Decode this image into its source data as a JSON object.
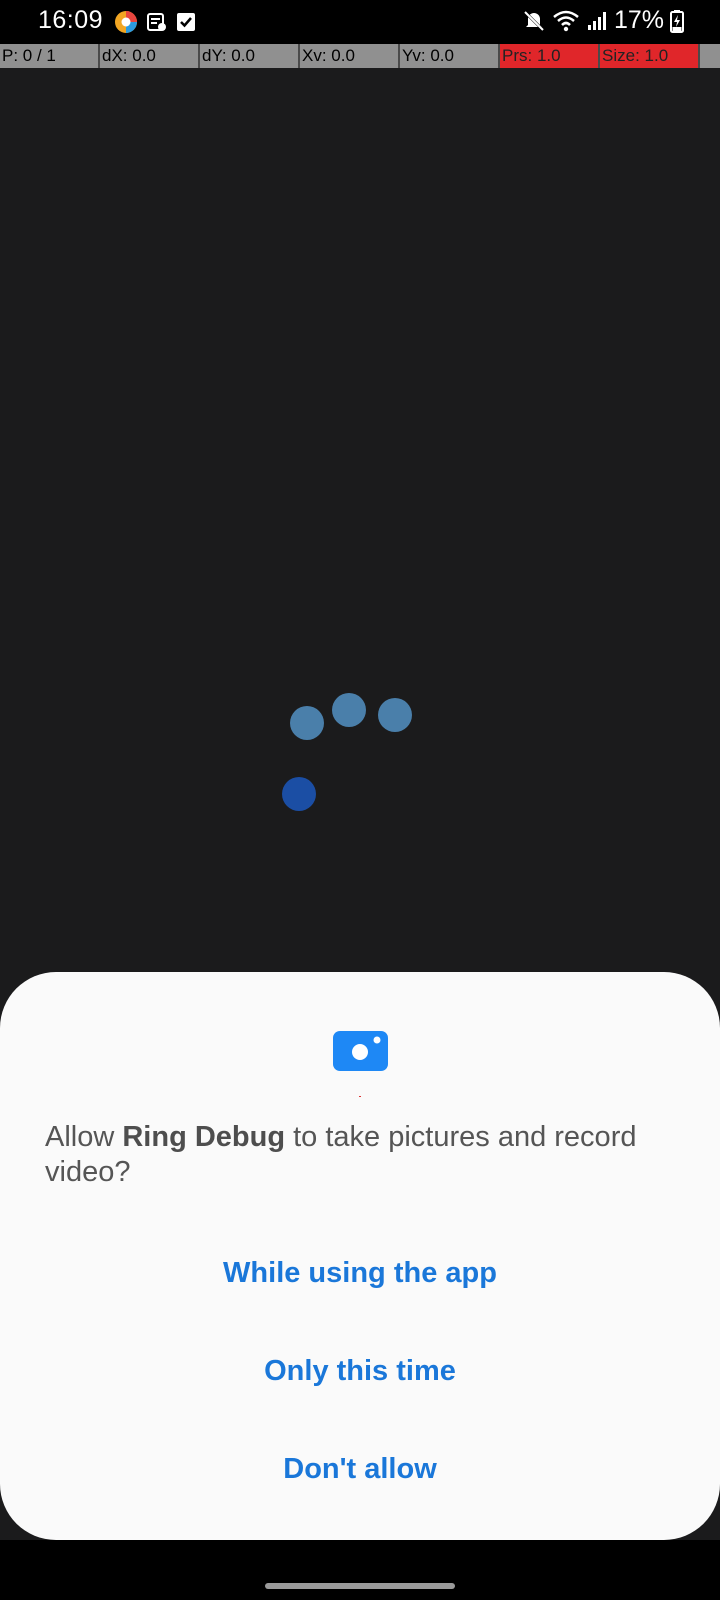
{
  "status_bar": {
    "time": "16:09",
    "battery": "17%",
    "notification_icons": [
      "app-logo-icon",
      "calendar-note-icon",
      "checkbox-icon"
    ],
    "system_icons": [
      "mute-icon",
      "wifi-icon",
      "signal-icon",
      "battery-charging-icon"
    ]
  },
  "pointer_location": {
    "cells": [
      "P: 0 / 1",
      "dX: 0.0",
      "dY: 0.0",
      "Xv: 0.0",
      "Yv: 0.0",
      "Prs: 1.0",
      "Size: 1.0"
    ]
  },
  "dialog": {
    "icon": "camera-icon",
    "message_prefix": "Allow ",
    "app_name": "Ring Debug",
    "message_suffix": " to take pictures and record video?",
    "buttons": {
      "while_using": "While using the app",
      "only_this_time": "Only this time",
      "dont_allow": "Don't allow"
    }
  },
  "colors": {
    "accent": "#1a77d9",
    "camera_icon": "#1e88f5",
    "loading_dot": "#4a7faa",
    "touch_dot": "#1b4ea4"
  }
}
